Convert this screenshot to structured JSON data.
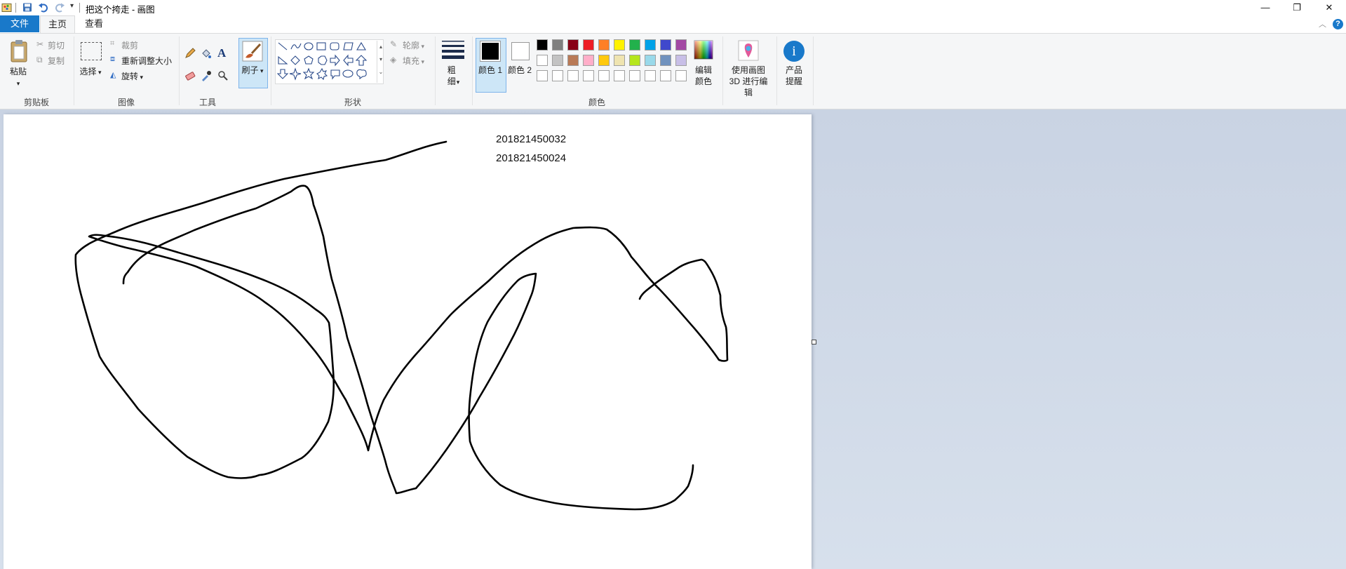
{
  "window": {
    "title": "把这个挎走 - 画图",
    "controls": {
      "minimize": "—",
      "restore": "❐",
      "close": "✕"
    }
  },
  "menu": {
    "file": "文件",
    "tabs": [
      "主页",
      "查看"
    ]
  },
  "ribbon": {
    "clipboard": {
      "paste": "粘贴",
      "cut": "剪切",
      "copy": "复制",
      "group": "剪贴板"
    },
    "image": {
      "select": "选择",
      "crop": "裁剪",
      "resize": "重新调整大小",
      "rotate": "旋转",
      "group": "图像"
    },
    "tools": {
      "group": "工具"
    },
    "brush": {
      "label": "刷子"
    },
    "shapes": {
      "outline": "轮廓",
      "fill": "填充",
      "group": "形状"
    },
    "size": {
      "label": "粗细"
    },
    "color1": {
      "label": "颜色 1"
    },
    "color2": {
      "label": "颜色 2"
    },
    "colors": {
      "group": "颜色",
      "edit": "编辑颜色",
      "palette_row1": [
        "#000000",
        "#7f7f7f",
        "#880015",
        "#ed1c24",
        "#ff7f27",
        "#fff200",
        "#22b14c",
        "#00a2e8",
        "#3f48cc",
        "#a349a4"
      ],
      "palette_row2": [
        "#ffffff",
        "#c3c3c3",
        "#b97a57",
        "#ffaec9",
        "#ffc90e",
        "#efe4b0",
        "#b5e61d",
        "#99d9ea",
        "#7092be",
        "#c8bfe7"
      ],
      "palette_row3": [
        "#ffffff",
        "#ffffff",
        "#ffffff",
        "#ffffff",
        "#ffffff",
        "#ffffff",
        "#ffffff",
        "#ffffff",
        "#ffffff",
        "#ffffff"
      ],
      "color1_value": "#000000",
      "color2_value": "#ffffff"
    },
    "paint3d": {
      "label": "使用画图 3D 进行编辑"
    },
    "product": {
      "label": "产品提醒"
    }
  },
  "canvas": {
    "texts": [
      "201821450032",
      "201821450024"
    ]
  }
}
